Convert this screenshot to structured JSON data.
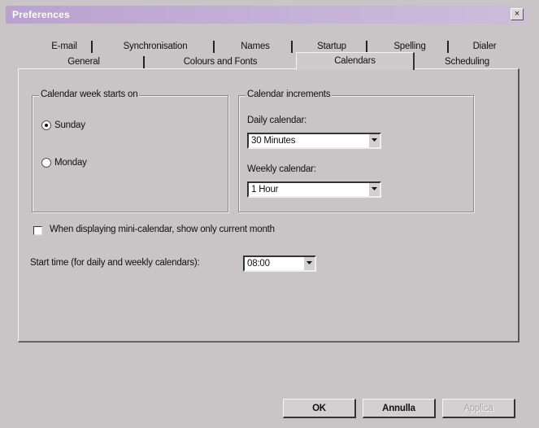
{
  "window": {
    "title": "Preferences",
    "close_glyph": "×"
  },
  "tabs_back_row": [
    {
      "label": "E-mail"
    },
    {
      "label": "Synchronisation"
    },
    {
      "label": "Names"
    },
    {
      "label": "Startup"
    },
    {
      "label": "Spelling"
    },
    {
      "label": "Dialer"
    }
  ],
  "tabs_front_row": [
    {
      "label": "General"
    },
    {
      "label": "Colours and Fonts"
    },
    {
      "label": "Calendars",
      "selected": true
    },
    {
      "label": "Scheduling"
    }
  ],
  "week_start": {
    "title": "Calendar week starts on",
    "options": [
      {
        "label": "Sunday",
        "selected": true
      },
      {
        "label": "Monday",
        "selected": false
      }
    ]
  },
  "increments": {
    "title": "Calendar increments",
    "daily_label": "Daily calendar:",
    "daily_value": "30 Minutes",
    "weekly_label": "Weekly calendar:",
    "weekly_value": "1 Hour"
  },
  "mini_calendar": {
    "label": "When displaying mini-calendar, show only current month",
    "checked": false
  },
  "start_time": {
    "label": "Start time (for daily and weekly calendars):",
    "value": "08:00"
  },
  "buttons": {
    "ok": "OK",
    "cancel": "Annulla",
    "apply": "Applica"
  }
}
